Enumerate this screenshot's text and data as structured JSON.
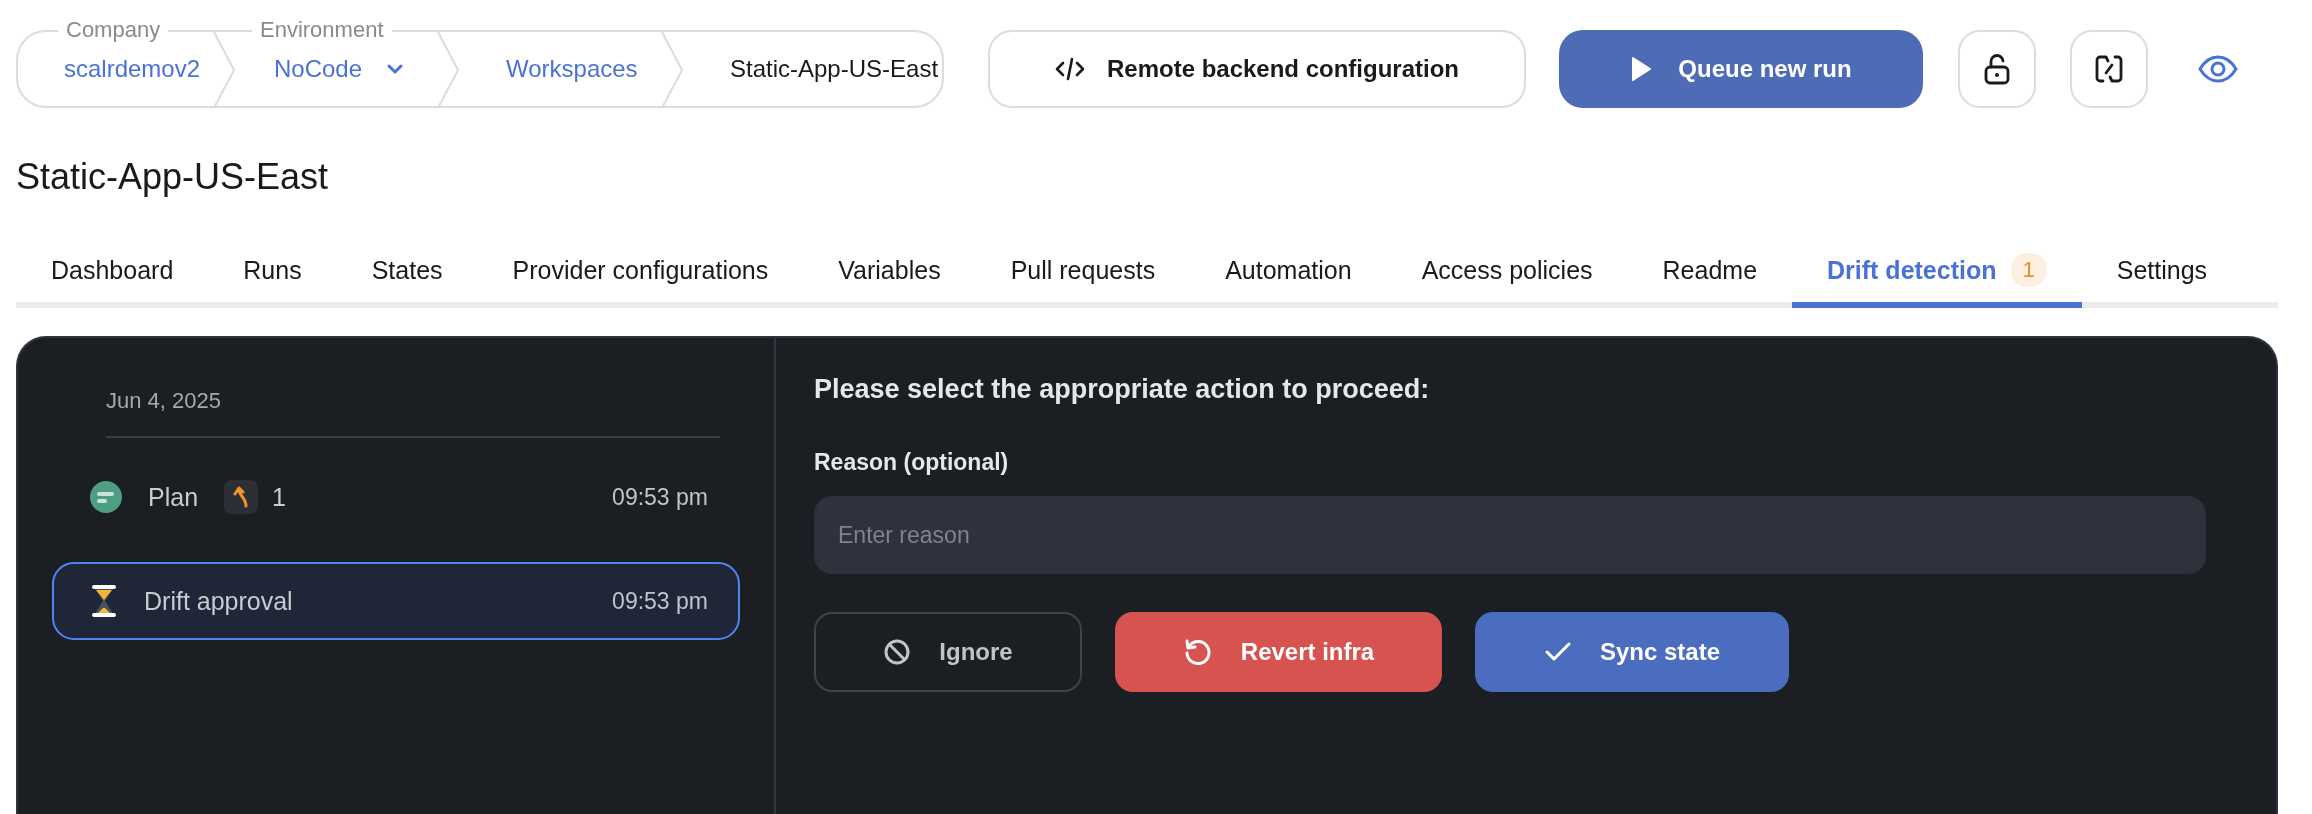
{
  "breadcrumb": [
    {
      "kind": "link",
      "label": "Company",
      "value": "scalrdemov2"
    },
    {
      "kind": "dropdown",
      "label": "Environment",
      "value": "NoCode"
    },
    {
      "kind": "link",
      "value": "Workspaces"
    },
    {
      "kind": "current",
      "value": "Static-App-US-East"
    }
  ],
  "backend_button": {
    "label": "Remote backend configuration"
  },
  "run_button": {
    "label": "Queue new run"
  },
  "title": "Static-App-US-East",
  "tabs": [
    {
      "label": "Dashboard",
      "selected": false
    },
    {
      "label": "Runs",
      "selected": false
    },
    {
      "label": "States",
      "selected": false
    },
    {
      "label": "Provider configurations",
      "selected": false
    },
    {
      "label": "Variables",
      "selected": false
    },
    {
      "label": "Pull requests",
      "selected": false
    },
    {
      "label": "Automation",
      "selected": false
    },
    {
      "label": "Access policies",
      "selected": false
    },
    {
      "label": "Readme",
      "selected": false
    },
    {
      "label": "Drift detection",
      "selected": true,
      "badge": "1"
    },
    {
      "label": "Settings",
      "selected": false
    }
  ],
  "history": {
    "date": "Jun 4, 2025",
    "items": [
      {
        "kind": "plan",
        "label": "Plan",
        "count": "1",
        "time": "09:53 pm",
        "selected": false
      },
      {
        "kind": "approval",
        "label": "Drift approval",
        "time": "09:53 pm",
        "selected": true
      }
    ]
  },
  "form": {
    "prompt": "Please select the appropriate action to proceed:",
    "reason_label": "Reason (optional)",
    "reason_placeholder": "Enter reason",
    "actions": [
      {
        "kind": "ignore",
        "label": "Ignore"
      },
      {
        "kind": "revert",
        "label": "Revert infra"
      },
      {
        "kind": "sync",
        "label": "Sync state"
      }
    ]
  }
}
